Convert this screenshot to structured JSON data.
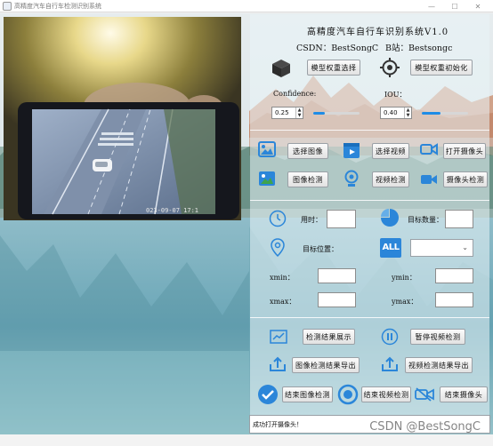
{
  "window": {
    "title": "高精度汽车自行车检测识别系统",
    "controls": [
      "—",
      "☐",
      "✕"
    ]
  },
  "header": {
    "title": "高精度汽车自行车识别系统V1.0",
    "csdn": "CSDN：BestSongC",
    "bilibili": "B站：Bestsongc"
  },
  "model": {
    "select_label": "模型权重选择",
    "init_label": "模型权重初始化",
    "confidence_label": "Confidence:",
    "confidence_value": "0.25",
    "confidence_fraction": 0.25,
    "iou_label": "IOU：",
    "iou_value": "0.40",
    "iou_fraction": 0.4
  },
  "sources": {
    "select_image": "选择图像",
    "select_video": "选择视频",
    "open_camera": "打开摄像头",
    "image_detect": "图像检测",
    "video_detect": "视频检测",
    "camera_detect": "摄像头检测"
  },
  "results": {
    "time_label": "用时：",
    "time_value": "",
    "count_label": "目标数量：",
    "count_value": "",
    "position_label": "目标位置：",
    "target_select_value": "",
    "all_icon_text": "ALL",
    "xmin_label": "xmin：",
    "ymin_label": "ymin：",
    "xmax_label": "xmax：",
    "ymax_label": "ymax："
  },
  "actions": {
    "show_results": "检测结果展示",
    "pause_video": "暂停视频检测",
    "export_image": "图像检测结果导出",
    "export_video": "视频检测结果导出",
    "end_image": "结束图像检测",
    "end_video": "结束视频检测",
    "end_camera": "结束摄像头"
  },
  "status": {
    "message": "成功打开摄像头！"
  },
  "watermark": "CSDN @BestSongC",
  "colors": {
    "accent": "#1e8ce6",
    "icon_blue": "#2b86d9",
    "icon_dark": "#3c3c3c"
  }
}
